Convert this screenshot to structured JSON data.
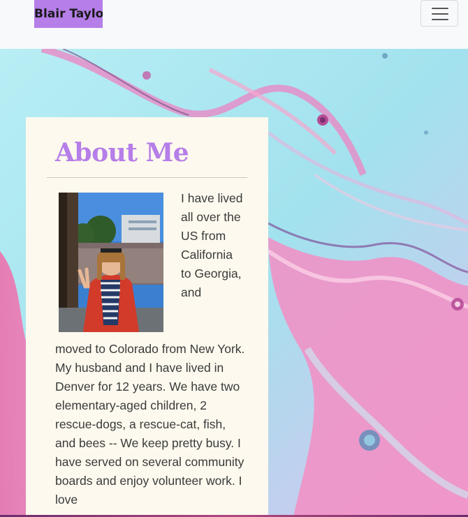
{
  "navbar": {
    "brand": "Blair Taylor",
    "toggler_icon": "hamburger-icon"
  },
  "about": {
    "heading": "About Me",
    "photo_icon": "profile-photo",
    "text_wrap": "I have lived all over the US from California to Georgia, and",
    "text_full": "moved to Colorado from New York. My husband and I have lived in Denver for 12 years. We have two elementary-aged children, 2 rescue-dogs, a rescue-cat, fish, and bees -- We keep pretty busy. I have served on several community boards and enjoy volunteer work. I love"
  },
  "colors": {
    "accent": "#b57ee8",
    "card_background": "#fdf9ee",
    "navbar_background": "#f8f9fa",
    "marble_blue": "#a6e6ef",
    "marble_pink": "#f07bb4"
  }
}
